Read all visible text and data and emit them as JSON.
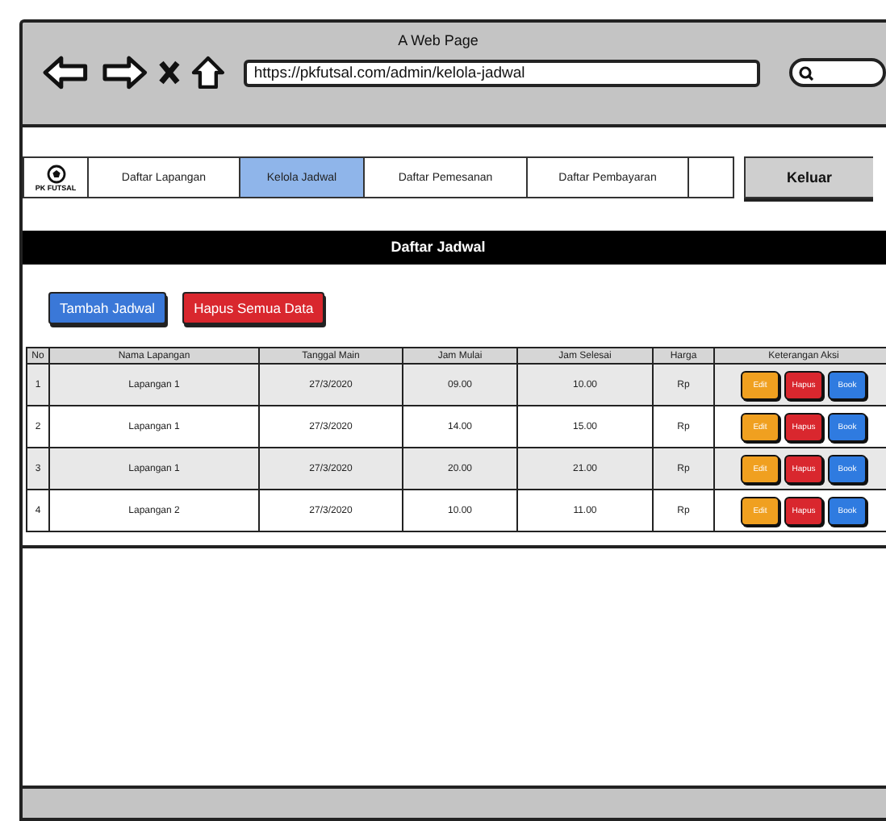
{
  "window": {
    "title": "A Web Page",
    "url": "https://pkfutsal.com/admin/kelola-jadwal"
  },
  "nav": {
    "logo_text": "PK FUTSAL",
    "logout": "Keluar",
    "tabs": [
      {
        "label": "Daftar Lapangan",
        "selected": false
      },
      {
        "label": "Kelola Jadwal",
        "selected": true
      },
      {
        "label": "Daftar Pemesanan",
        "selected": false
      },
      {
        "label": "Daftar Pembayaran",
        "selected": false
      }
    ]
  },
  "section_title": "Daftar Jadwal",
  "actions": [
    {
      "label": "Tambah Jadwal",
      "kind": "primary"
    },
    {
      "label": "Hapus Semua Data",
      "kind": "danger"
    }
  ],
  "table": {
    "columns": [
      "No",
      "Nama Lapangan",
      "Tanggal Main",
      "Jam Mulai",
      "Jam Selesai",
      "Harga",
      "Keterangan Aksi"
    ],
    "rows": [
      {
        "cells": [
          "1",
          "Lapangan 1",
          "27/3/2020",
          "09.00",
          "10.00",
          "Rp"
        ],
        "actions": [
          {
            "label": "Edit",
            "kind": "edit"
          },
          {
            "label": "Hapus",
            "kind": "delete"
          },
          {
            "label": "Book",
            "kind": "book"
          }
        ]
      },
      {
        "cells": [
          "2",
          "Lapangan 1",
          "27/3/2020",
          "14.00",
          "15.00",
          "Rp"
        ],
        "actions": [
          {
            "label": "Edit",
            "kind": "edit"
          },
          {
            "label": "Hapus",
            "kind": "delete"
          },
          {
            "label": "Book",
            "kind": "book"
          }
        ]
      },
      {
        "cells": [
          "3",
          "Lapangan 1",
          "27/3/2020",
          "20.00",
          "21.00",
          "Rp"
        ],
        "actions": [
          {
            "label": "Edit",
            "kind": "edit"
          },
          {
            "label": "Hapus",
            "kind": "delete"
          },
          {
            "label": "Book",
            "kind": "book"
          }
        ]
      },
      {
        "cells": [
          "4",
          "Lapangan 2",
          "27/3/2020",
          "10.00",
          "11.00",
          "Rp"
        ],
        "actions": [
          {
            "label": "Edit",
            "kind": "edit"
          },
          {
            "label": "Hapus",
            "kind": "delete"
          },
          {
            "label": "Book",
            "kind": "book"
          }
        ]
      }
    ]
  }
}
